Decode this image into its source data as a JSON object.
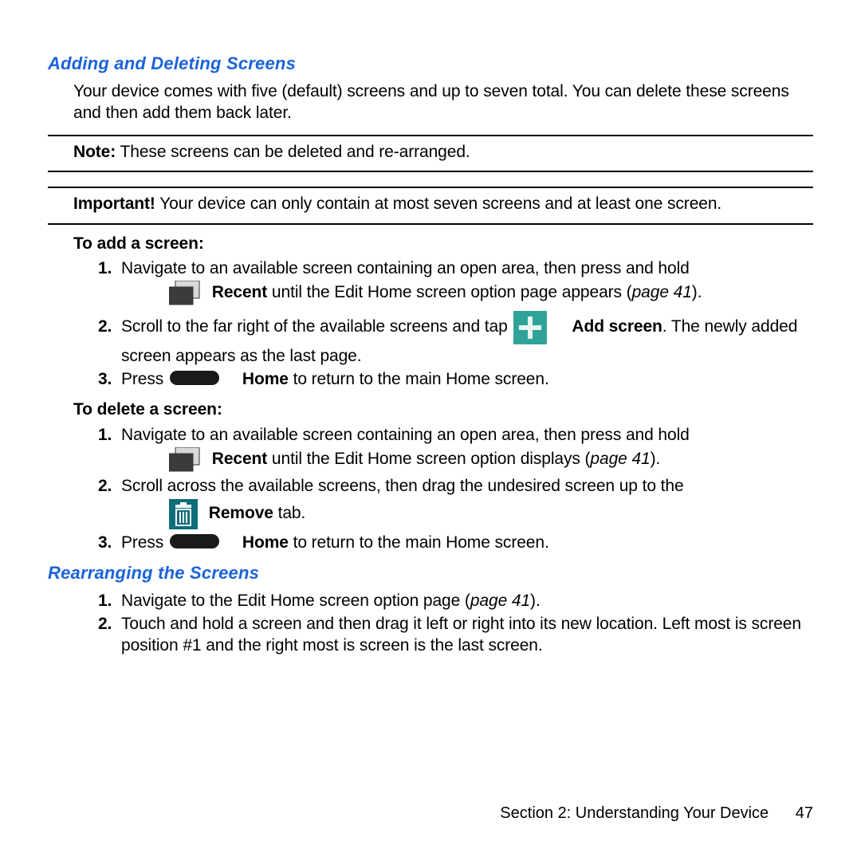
{
  "heading1": "Adding and Deleting Screens",
  "intro": "Your device comes with five (default) screens and up to seven total. You can delete these screens and then add them back later.",
  "note_label": "Note:",
  "note_text": " These screens can be deleted and re-arranged.",
  "important_label": "Important!",
  "important_text": " Your device can only contain at most seven screens and at least one screen.",
  "add_label": "To add a screen:",
  "add1_a": "Navigate to an available screen containing an open area, then press and hold",
  "add1_b_bold": "Recent",
  "add1_b_rest": " until the Edit Home screen option page appears (",
  "add1_b_pageref": "page 41",
  "add1_b_close": ").",
  "add2_a": "Scroll to the far right of the available screens and tap ",
  "add2_b_bold": "Add screen",
  "add2_b_rest": ". The newly added screen appears as the last page.",
  "add3_a": "Press ",
  "add3_b_bold": "Home",
  "add3_b_rest": " to return to the main Home screen.",
  "del_label": "To delete a screen:",
  "del1_a": "Navigate to an available screen containing an open area, then press and hold",
  "del1_b_bold": "Recent",
  "del1_b_rest": " until the Edit Home screen option displays (",
  "del1_b_pageref": "page 41",
  "del1_b_close": ").",
  "del2_a": "Scroll across the available screens, then drag the undesired screen up to the",
  "del2_b_bold": "Remove",
  "del2_b_rest": " tab.",
  "del3_a": "Press ",
  "del3_b_bold": "Home",
  "del3_b_rest": " to return to the main Home screen.",
  "heading2": "Rearranging the Screens",
  "re1_a": "Navigate to the Edit Home screen option page (",
  "re1_pageref": "page 41",
  "re1_close": ").",
  "re2": "Touch and hold a screen and then drag it left or right into its new location. Left most is screen position #1 and the right most is screen is the last screen.",
  "footer_section": "Section 2:  Understanding Your Device",
  "footer_page": "47"
}
